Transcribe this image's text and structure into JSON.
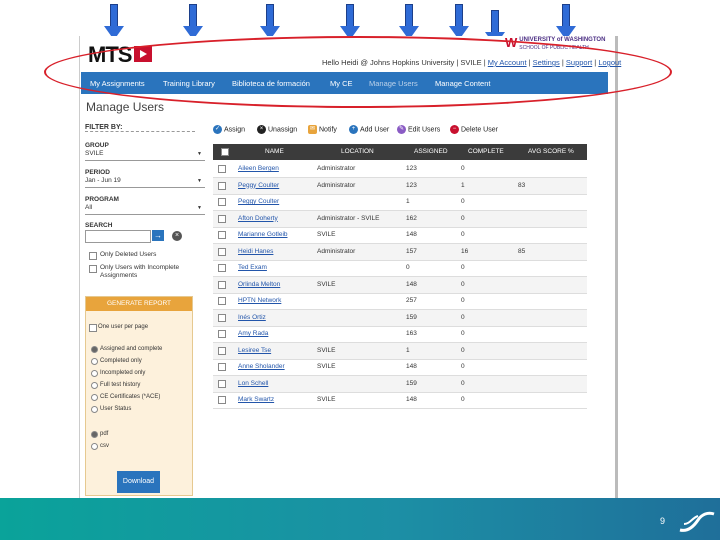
{
  "app": {
    "logo_text": "MTS",
    "uw_line1": "UNIVERSITY of WASHINGTON",
    "uw_line2": "SCHOOL OF PUBLIC HEALTH"
  },
  "userbar": {
    "greeting": "Hello Heidi @ Johns Hopkins University",
    "site": "SVILE",
    "links": [
      "My Account",
      "Settings",
      "Support",
      "Logout"
    ]
  },
  "nav": {
    "items": [
      "My Assignments",
      "Training Library",
      "Biblioteca de formación",
      "My CE",
      "Manage Users",
      "Manage Content"
    ]
  },
  "page": {
    "title": "Manage Users"
  },
  "filters": {
    "heading": "FILTER BY:",
    "group_label": "GROUP",
    "group_value": "SVILE",
    "period_label": "PERIOD",
    "period_value": "Jan - Jun 19",
    "program_label": "PROGRAM",
    "program_value": "All",
    "search_label": "SEARCH",
    "only_deleted": "Only Deleted Users",
    "only_incomplete": "Only Users with Incomplete Assignments"
  },
  "report": {
    "header": "GENERATE REPORT",
    "one_user": "One user per page",
    "options": [
      "Assigned and complete",
      "Completed only",
      "Incompleted only",
      "Full test history",
      "CE Certificates (*ACE)",
      "User Status"
    ],
    "formats": [
      "pdf",
      "csv"
    ],
    "download_label": "Download"
  },
  "toolbar": {
    "assign": "Assign",
    "unassign": "Unassign",
    "notify": "Notify",
    "add_user": "Add User",
    "edit_users": "Edit Users",
    "delete_user": "Delete User"
  },
  "table": {
    "columns": [
      "NAME",
      "LOCATION",
      "ASSIGNED",
      "COMPLETE",
      "AVG SCORE %"
    ],
    "rows": [
      {
        "name": "Aileen Bergen",
        "location": "Administrator",
        "assigned": "123",
        "complete": "0",
        "avg": ""
      },
      {
        "name": "Peggy Coulter",
        "location": "Administrator",
        "assigned": "123",
        "complete": "1",
        "avg": "83"
      },
      {
        "name": "Peggy Coulter",
        "location": "",
        "assigned": "1",
        "complete": "0",
        "avg": ""
      },
      {
        "name": "Afton Doherty",
        "location": "Administrator - SVILE",
        "assigned": "162",
        "complete": "0",
        "avg": ""
      },
      {
        "name": "Marianne Gotleib",
        "location": "SVILE",
        "assigned": "148",
        "complete": "0",
        "avg": ""
      },
      {
        "name": "Heidi Hanes",
        "location": "Administrator",
        "assigned": "157",
        "complete": "16",
        "avg": "85"
      },
      {
        "name": "Ted Exam",
        "location": "",
        "assigned": "0",
        "complete": "0",
        "avg": ""
      },
      {
        "name": "Orlinda Melton",
        "location": "SVILE",
        "assigned": "148",
        "complete": "0",
        "avg": ""
      },
      {
        "name": "HPTN Network",
        "location": "",
        "assigned": "257",
        "complete": "0",
        "avg": ""
      },
      {
        "name": "Inés Ortiz",
        "location": "",
        "assigned": "159",
        "complete": "0",
        "avg": ""
      },
      {
        "name": "Amy Rada",
        "location": "",
        "assigned": "163",
        "complete": "0",
        "avg": ""
      },
      {
        "name": "Lesiree Tse",
        "location": "SVILE",
        "assigned": "1",
        "complete": "0",
        "avg": ""
      },
      {
        "name": "Anne Sholander",
        "location": "SVILE",
        "assigned": "148",
        "complete": "0",
        "avg": ""
      },
      {
        "name": "Lon Schell",
        "location": "",
        "assigned": "159",
        "complete": "0",
        "avg": ""
      },
      {
        "name": "Mark Swartz",
        "location": "SVILE",
        "assigned": "148",
        "complete": "0",
        "avg": ""
      }
    ]
  },
  "slide": {
    "page_number": "9"
  },
  "colors": {
    "nav": "#2a74bd",
    "highlight": "#d8202a",
    "arrow": "#2f6bd6",
    "report": "#e8a43c"
  }
}
